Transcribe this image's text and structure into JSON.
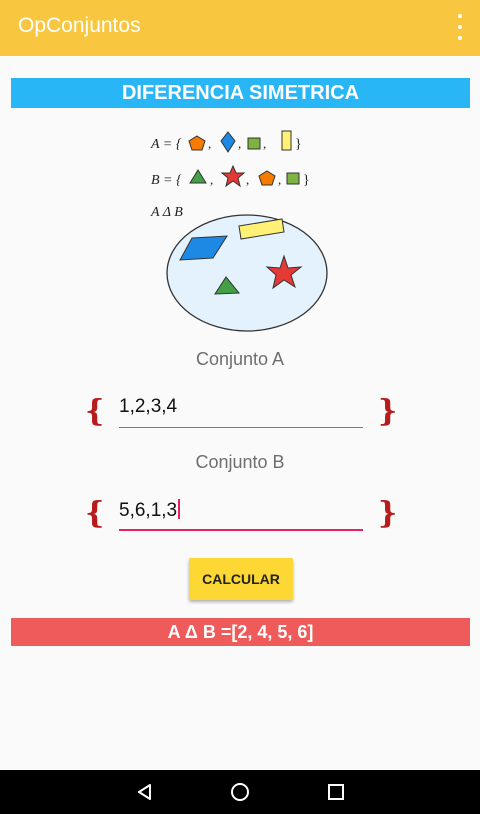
{
  "appbar": {
    "title": "OpConjuntos",
    "menu_icon": "overflow-menu-icon"
  },
  "banner": {
    "text": "DIFERENCIA SIMETRICA"
  },
  "illustration": {
    "set_a": "A = {",
    "set_b": "B = {",
    "set_ab": "A Δ B"
  },
  "set_a": {
    "label": "Conjunto A",
    "value": "1,2,3,4",
    "open_brace": "{",
    "close_brace": "}"
  },
  "set_b": {
    "label": "Conjunto B",
    "value": "5,6,1,3",
    "open_brace": "{",
    "close_brace": "}"
  },
  "calc_button": {
    "label": "CALCULAR"
  },
  "result": {
    "text": "A Δ B =[2, 4, 5, 6]"
  },
  "colors": {
    "appbar": "#f9c73f",
    "banner": "#29b6f6",
    "result": "#ef5a5a",
    "button": "#fdd835",
    "brace": "#b71c1c"
  },
  "navbar": {
    "back_icon": "back-icon",
    "home_icon": "home-icon",
    "recents_icon": "recents-icon"
  }
}
